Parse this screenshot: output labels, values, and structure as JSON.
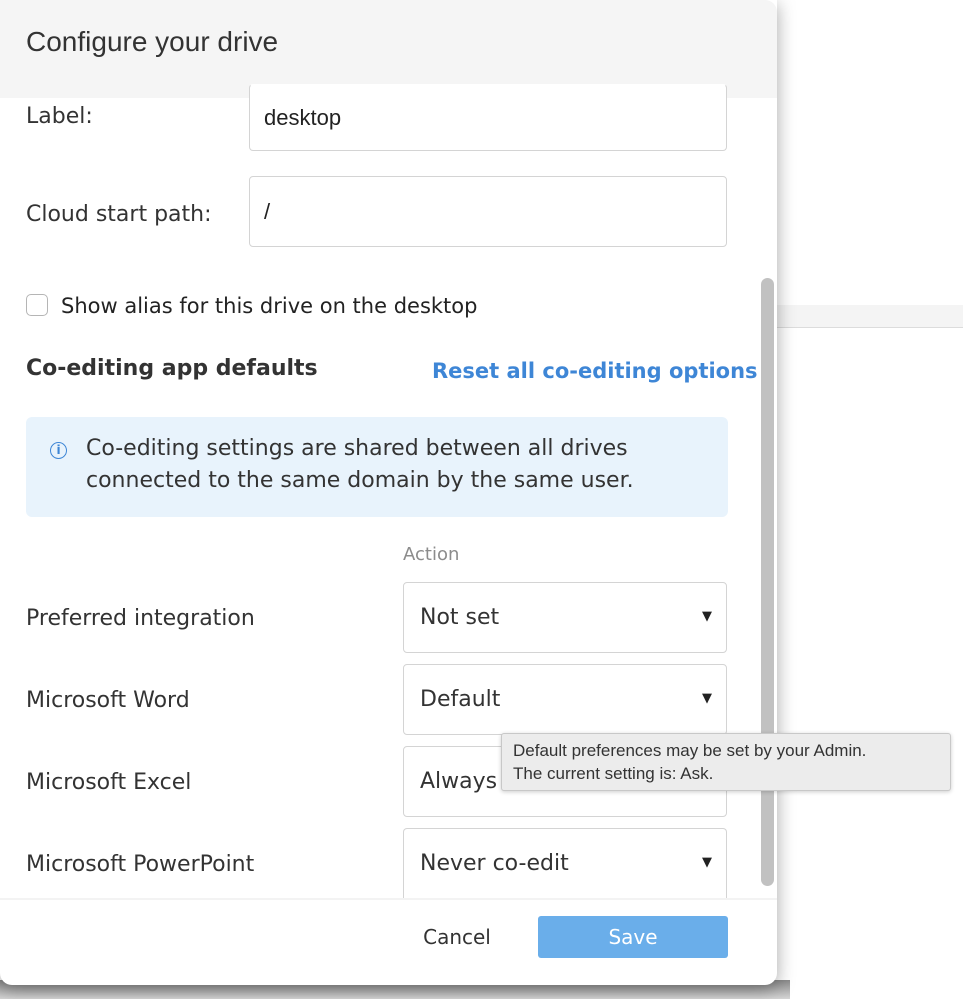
{
  "dialog": {
    "title": "Configure your drive"
  },
  "form": {
    "label_label": "Label:",
    "label_value": "desktop",
    "cloud_path_label": "Cloud start path:",
    "cloud_path_value": "/",
    "show_alias_label": "Show alias for this drive on the desktop",
    "show_alias_checked": false
  },
  "coediting": {
    "section_title": "Co-editing app defaults",
    "reset_link": "Reset all co-editing options",
    "info_icon": "info-circle-icon",
    "info_text": "Co-editing settings are shared between all drives connected to the same domain by the same user.",
    "column_header": "Action",
    "rows": [
      {
        "label": "Preferred integration",
        "value": "Not set"
      },
      {
        "label": "Microsoft Word",
        "value": "Default"
      },
      {
        "label": "Microsoft Excel",
        "value": "Always co-edit"
      },
      {
        "label": "Microsoft PowerPoint",
        "value": "Never co-edit"
      }
    ]
  },
  "tooltip": {
    "line1": "Default preferences may be set by your Admin.",
    "line2": "The current setting is: Ask."
  },
  "footer": {
    "cancel_label": "Cancel",
    "save_label": "Save"
  },
  "colors": {
    "accent": "#3e86d6",
    "save_button": "#6aaeea",
    "info_background": "#e8f3fc"
  }
}
